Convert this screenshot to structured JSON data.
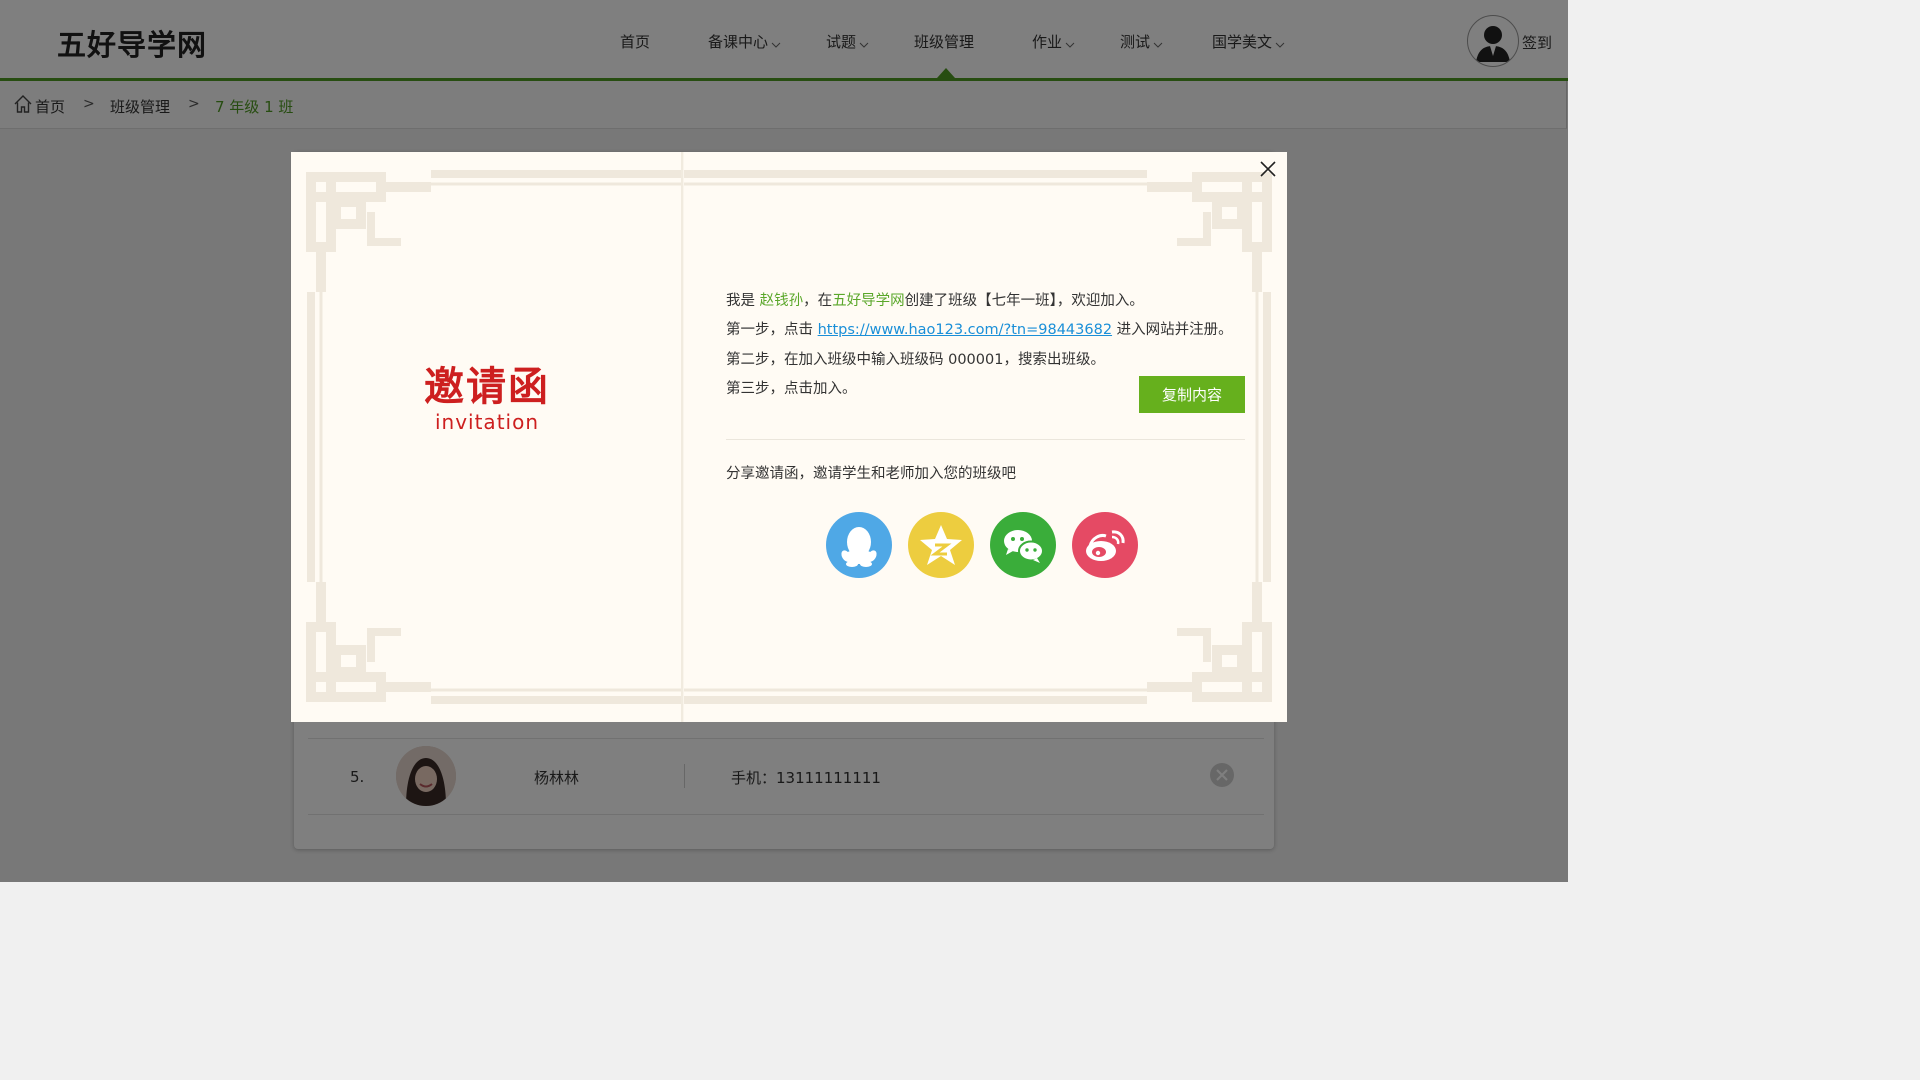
{
  "site": {
    "logo": "五好导学网"
  },
  "nav": {
    "items": [
      {
        "label": "首页",
        "dropdown": false
      },
      {
        "label": "备课中心",
        "dropdown": true
      },
      {
        "label": "试题",
        "dropdown": true
      },
      {
        "label": "班级管理",
        "dropdown": false,
        "active": true
      },
      {
        "label": "作业",
        "dropdown": true
      },
      {
        "label": "测试",
        "dropdown": true
      },
      {
        "label": "国学美文",
        "dropdown": true
      }
    ],
    "signin_label": "签到"
  },
  "breadcrumb": {
    "items": [
      "首页",
      "班级管理",
      "7 年级 1 班"
    ],
    "separator": ">"
  },
  "background_list": {
    "rows": [
      {
        "index": "5.",
        "name": "杨林林",
        "phone": "手机：13111111111"
      }
    ]
  },
  "modal": {
    "title": "邀请函",
    "subtitle": "invitation",
    "line1": {
      "prefix": "我是 ",
      "name": "赵钱孙",
      "mid": "，在",
      "site": "五好导学网",
      "suffix": "创建了班级【七年一班】，欢迎加入。"
    },
    "line2": {
      "prefix": "第一步，点击 ",
      "url": "https://www.hao123.com/?tn=98443682",
      "suffix": " 进入网站并注册。"
    },
    "line3": "第二步，在加入班级中输入班级码 000001，搜索出班级。",
    "line4": "第三步，点击加入。",
    "copy_button": "复制内容",
    "share_text": "分享邀请函，邀请学生和老师加入您的班级吧",
    "share_icons": [
      {
        "name": "qq-icon",
        "color": "#4fa8e6"
      },
      {
        "name": "qzone-icon",
        "color": "#edcd3f"
      },
      {
        "name": "wechat-icon",
        "color": "#3aad3a"
      },
      {
        "name": "weibo-icon",
        "color": "#e54a64"
      }
    ]
  },
  "colors": {
    "brand_green": "#4f9a22",
    "invite_red": "#cd1f1f",
    "link_blue": "#1a8fd8",
    "modal_bg": "#fffbf4",
    "frame": "#efe8dc"
  }
}
